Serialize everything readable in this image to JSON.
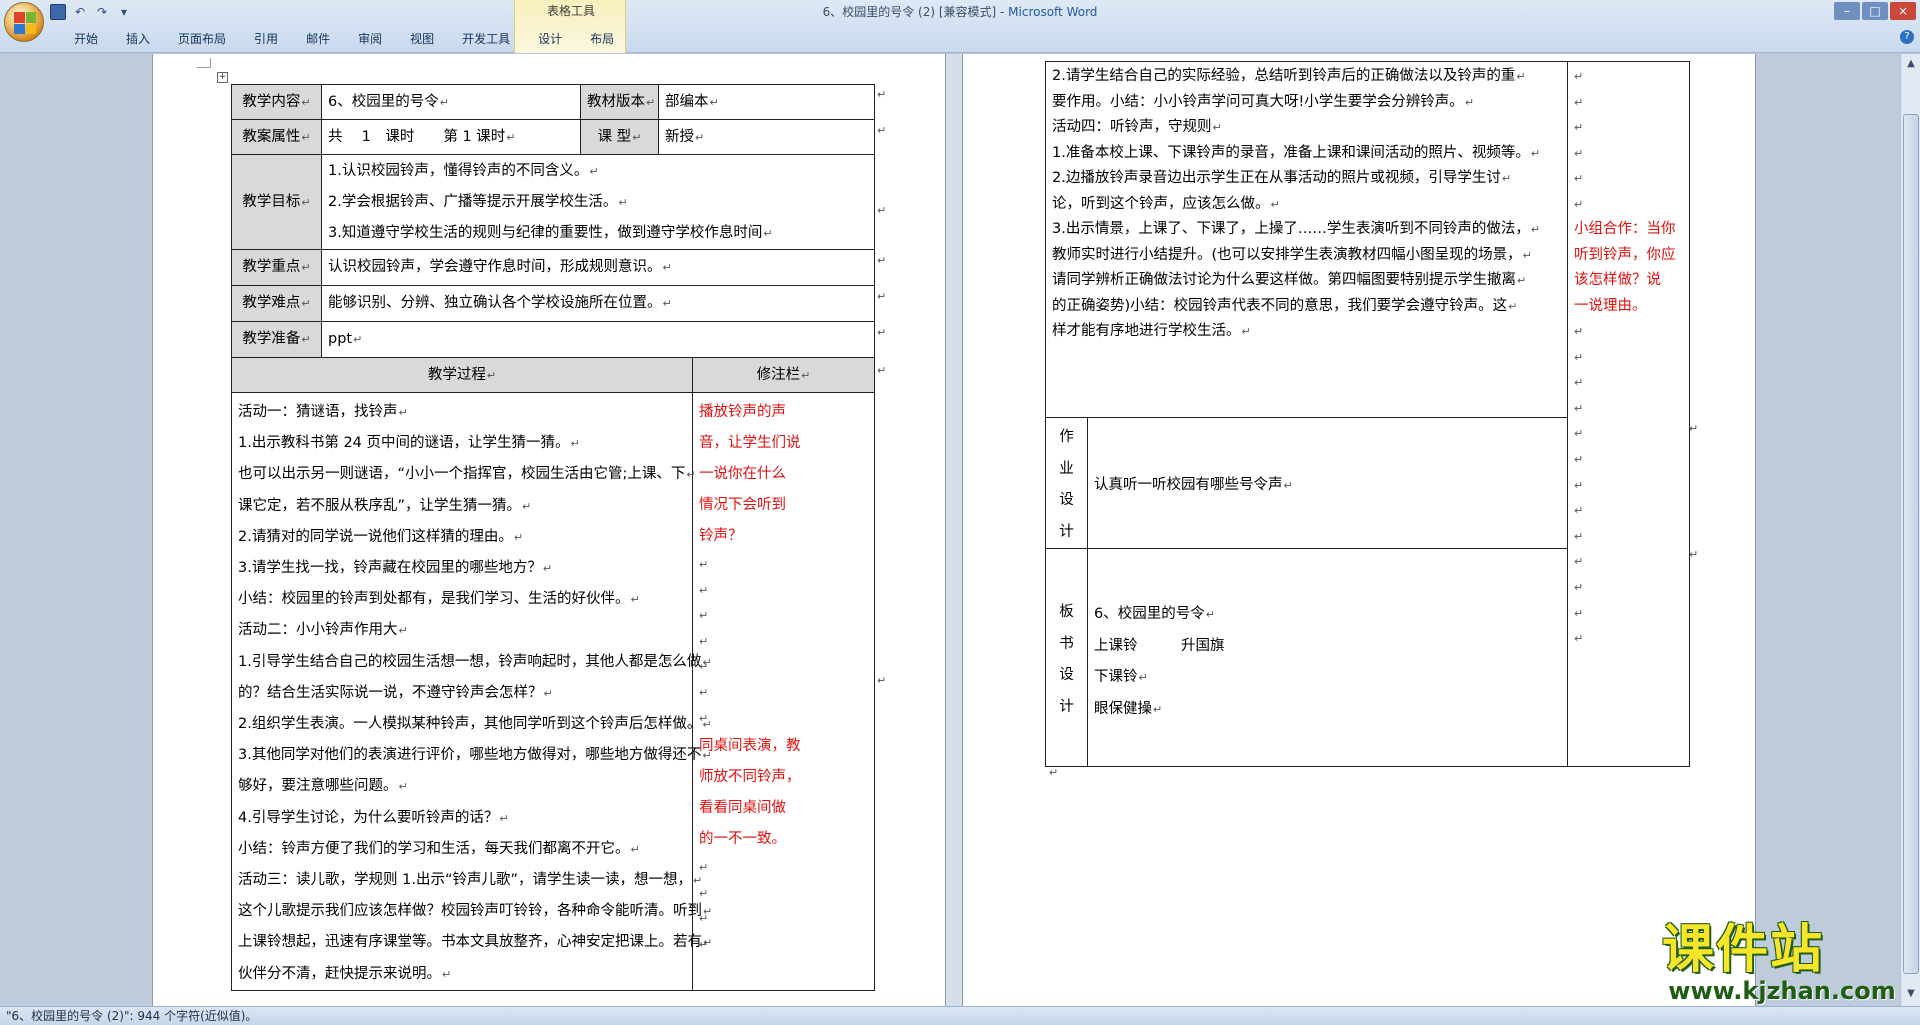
{
  "window": {
    "title": "6、校园里的号令 (2) [兼容模式] - ",
    "app_name": "Microsoft Word",
    "context_tools_label": "表格工具"
  },
  "ribbon": {
    "tabs": [
      "开始",
      "插入",
      "页面布局",
      "引用",
      "邮件",
      "审阅",
      "视图",
      "开发工具",
      "设计",
      "布局"
    ]
  },
  "para_mark": "↵",
  "left_table": {
    "r1": {
      "label": "教学内容",
      "value": "6、校园里的号令",
      "label2": "教材版本",
      "value2": "部编本"
    },
    "r2": {
      "label": "教案属性",
      "value": "共　 1　课时　　第 1 课时",
      "label2": "课 型",
      "value2": "新授"
    },
    "goals": {
      "label": "教学目标",
      "items": [
        "1.认识校园铃声，懂得铃声的不同含义。",
        "2.学会根据铃声、广播等提示开展学校生活。",
        "3.知道遵守学校生活的规则与纪律的重要性，做到遵守学校作息时间"
      ]
    },
    "key": {
      "label": "教学重点",
      "value": "认识校园铃声，学会遵守作息时间，形成规则意识。"
    },
    "difficult": {
      "label": "教学难点",
      "value": "能够识别、分辨、独立确认各个学校设施所在位置。"
    },
    "prep": {
      "label": "教学准备",
      "value": "ppt"
    },
    "process_header": "教学过程",
    "notes_header": "修注栏",
    "process_lines": [
      "活动一：猜谜语，找铃声",
      "1.出示教科书第 24 页中间的谜语，让学生猜一猜。",
      "也可以出示另一则谜语，“小小一个指挥官，校园生活由它管;上课、下",
      "课它定，若不服从秩序乱”，让学生猜一猜。",
      "2.请猜对的同学说一说他们这样猜的理由。",
      "3.请学生找一找，铃声藏在校园里的哪些地方？",
      "小结：校园里的铃声到处都有，是我们学习、生活的好伙伴。",
      "活动二：小小铃声作用大",
      "1.引导学生结合自己的校园生活想一想，铃声响起时，其他人都是怎么做",
      "的？结合生活实际说一说，不遵守铃声会怎样？",
      "2.组织学生表演。一人模拟某种铃声，其他同学听到这个铃声后怎样做。",
      "3.其他同学对他们的表演进行评价，哪些地方做得对，哪些地方做得还不",
      "够好，要注意哪些问题。",
      "4.引导学生讨论，为什么要听铃声的话？",
      "小结：铃声方便了我们的学习和生活，每天我们都离不开它。",
      "活动三：读儿歌，学规则 1.出示“铃声儿歌”，请学生读一读，想一想，",
      "这个儿歌提示我们应该怎样做？校园铃声叮铃铃，各种命令能听清。听到",
      "上课铃想起，迅速有序课堂等。书本文具放整齐，心神安定把课上。若有",
      "伙伴分不清，赶快提示来说明。"
    ],
    "note1_lines": [
      "播放铃声的声",
      "音，让学生们说",
      "一说你在什么",
      "情况下会听到",
      "铃声？"
    ],
    "note2_lines": [
      "同桌间表演，教",
      "师放不同铃声，",
      "看看同桌间做",
      "的一不一致。"
    ]
  },
  "right_table": {
    "process_lines": [
      "2.请学生结合自己的实际经验，总结听到铃声后的正确做法以及铃声的重",
      "要作用。小结：小小铃声学问可真大呀!小学生要学会分辨铃声。",
      "活动四：听铃声，守规则",
      "1.准备本校上课、下课铃声的录音，准备上课和课间活动的照片、视频等。",
      "2.边播放铃声录音边出示学生正在从事活动的照片或视频，引导学生讨",
      "论，听到这个铃声，应该怎么做。",
      "3.出示情景，上课了、下课了，上操了……学生表演听到不同铃声的做法，",
      "教师实时进行小结提升。(也可以安排学生表演教材四幅小图呈现的场景，",
      "请同学辨析正确做法讨论为什么要这样做。第四幅图要特别提示学生撤离",
      "的正确姿势)小结：校园铃声代表不同的意思，我们要学会遵守铃声。这",
      "样才能有序地进行学校生活。"
    ],
    "note_lines": [
      "小组合作：当你",
      "听到铃声，你应",
      "该怎样做？说",
      "一说理由。"
    ],
    "homework": {
      "label_chars": [
        "作",
        "业",
        "设",
        "计"
      ],
      "value": "认真听一听校园有哪些号令声"
    },
    "board": {
      "label_chars": [
        "板",
        "书",
        "设",
        "计"
      ],
      "lines": [
        "6、校园里的号令",
        "上课铃　　　升国旗",
        "下课铃",
        "眼保健操"
      ]
    }
  },
  "statusbar": {
    "text": "\"6、校园里的号令 (2)\": 944 个字符(近似值)。"
  },
  "watermark": {
    "main": "课件站",
    "url": "www.kjzhan.com"
  }
}
